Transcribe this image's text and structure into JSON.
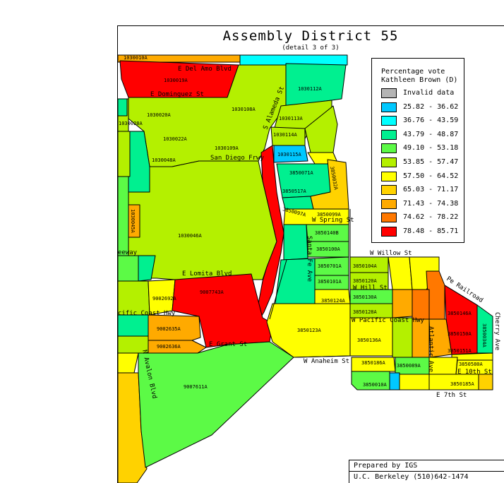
{
  "title": "Assembly District 55",
  "subtitle": "(detail 3 of 3)",
  "colors": {
    "invalid": "#b4b4b4",
    "c1": "#00c8ff",
    "c2": "#00ffff",
    "c3": "#00f090",
    "c4": "#5cfa46",
    "c5": "#b4f000",
    "c6": "#ffff00",
    "c7": "#ffd200",
    "c8": "#ffaa00",
    "c9": "#ff7800",
    "c10": "#ff0000"
  },
  "legend": {
    "title_line1": "Percentage vote",
    "title_line2": "Kathleen Brown (D)",
    "items": [
      {
        "label": "Invalid data",
        "color": "#b4b4b4"
      },
      {
        "label": "25.82 - 36.62",
        "color": "#00c8ff"
      },
      {
        "label": "36.76 - 43.59",
        "color": "#00ffff"
      },
      {
        "label": "43.79 - 48.87",
        "color": "#00f090"
      },
      {
        "label": "49.10 - 53.18",
        "color": "#5cfa46"
      },
      {
        "label": "53.85 - 57.47",
        "color": "#b4f000"
      },
      {
        "label": "57.50 - 64.52",
        "color": "#ffff00"
      },
      {
        "label": "65.03 - 71.17",
        "color": "#ffd200"
      },
      {
        "label": "71.43 - 74.38",
        "color": "#ffaa00"
      },
      {
        "label": "74.62 - 78.22",
        "color": "#ff7800"
      },
      {
        "label": "78.48 - 85.71",
        "color": "#ff0000"
      }
    ]
  },
  "streets": [
    "E Del Amo Blvd",
    "E Dominguez St",
    "S Alameda St",
    "San Diego Frwy",
    "W Spring St",
    "W Willow St",
    "Pe Railroad",
    "Santa Fe Ave",
    "W Hill St",
    "E Lomita Blvd",
    "W Pacific Coast Hwy",
    "cific Coast Hwy",
    "E Grant St",
    "W Anaheim St",
    "N Avalon Blvd",
    "Atlantic Ave",
    "Cherry Ave",
    "E 10th St",
    "E 7th St",
    "eeway"
  ],
  "precincts": [
    "1030010A",
    "1030019A",
    "1030112A",
    "1030020A",
    "1030108A",
    "1030113A",
    "1030028A",
    "1030022A",
    "1030114A",
    "1030109A",
    "1030115A",
    "1030048A",
    "3850071A",
    "3850032A",
    "3850517A",
    "3850097A",
    "3850099A",
    "3850140B",
    "3850100A",
    "1030046A",
    "3850104A",
    "3850701A",
    "3850101A",
    "3850120A",
    "3850130A",
    "3850124A",
    "9002692A",
    "9007743A",
    "3850128A",
    "3850123A",
    "9002635A",
    "9002636A",
    "3850136A",
    "3850186A",
    "3850089A",
    "3850185A",
    "9007611A",
    "3850010A",
    "3850146A",
    "3850150A",
    "3850151A",
    "3850580A",
    "3850034A",
    "1030045A"
  ],
  "credit": {
    "line1": "Prepared by IGS",
    "line2": "U.C. Berkeley (510)642-1474"
  }
}
